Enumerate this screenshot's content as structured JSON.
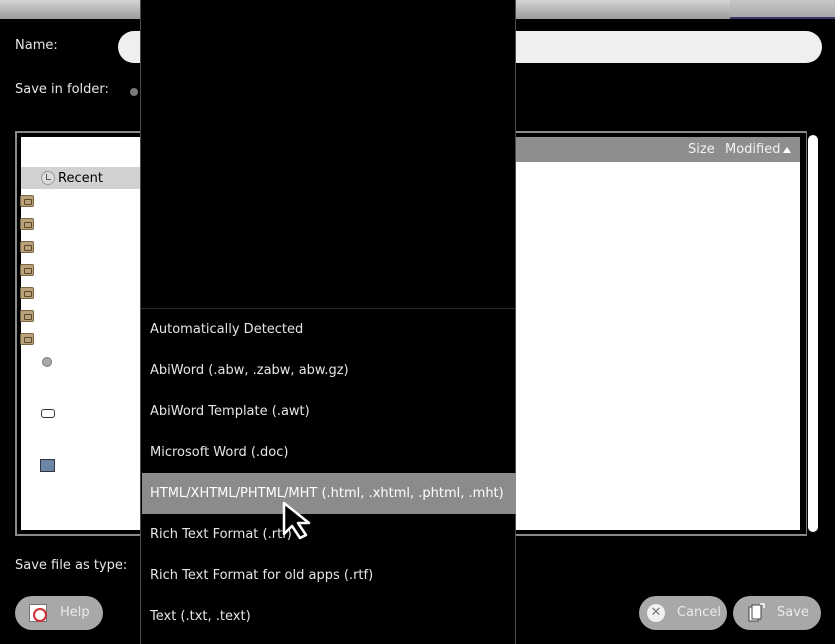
{
  "dialog": {
    "name_label": "Name:",
    "name_value": "",
    "folder_label": "Save in folder:",
    "filetype_label": "Save file as type:"
  },
  "places": {
    "recent_label": "Recent",
    "icons": [
      "recent-icon",
      "home-folder-icon",
      "desktop-folder-icon",
      "documents-folder-icon",
      "downloads-folder-icon",
      "music-folder-icon",
      "pictures-folder-icon",
      "videos-folder-icon",
      "filesystem-icon",
      "drive-icon",
      "network-icon"
    ]
  },
  "files": {
    "columns": [
      "Size",
      "Modified"
    ],
    "sort_column": "Modified",
    "sort_direction": "ascending"
  },
  "filetype_menu": {
    "items": [
      "Automatically Detected",
      "AbiWord (.abw, .zabw, abw.gz)",
      "AbiWord Template (.awt)",
      "Microsoft Word (.doc)",
      "HTML/XHTML/PHTML/MHT (.html, .xhtml, .phtml, .mht)",
      "Rich Text Format (.rtf)",
      "Rich Text Format for old apps (.rtf)",
      "Text (.txt, .text)"
    ],
    "highlighted_index": 4
  },
  "buttons": {
    "help": "Help",
    "cancel": "Cancel",
    "save": "Save"
  },
  "colors": {
    "background": "#000000",
    "highlight": "#8b8b8b",
    "button": "#a8a8a8"
  }
}
